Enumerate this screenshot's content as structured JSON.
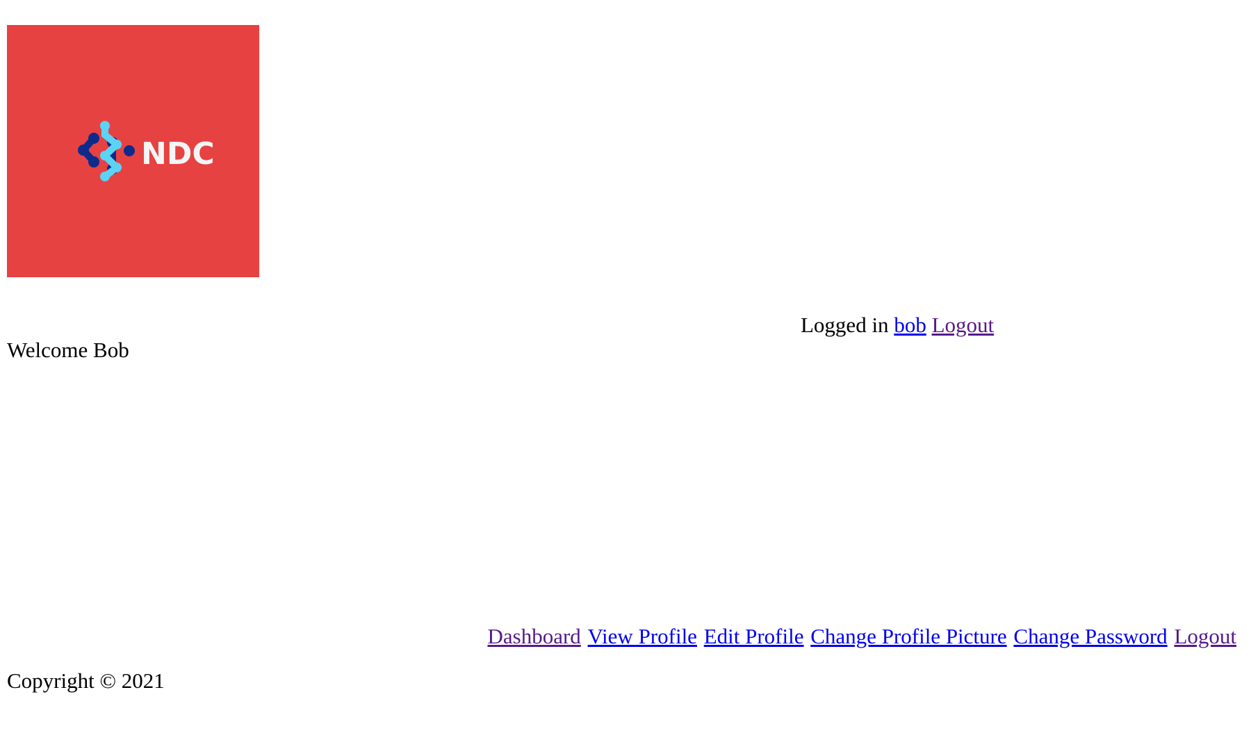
{
  "logo": {
    "text": "NDC",
    "background_color": "#e64242",
    "mark_colors": [
      "#0d2b8a",
      "#5bd3f5"
    ],
    "icon": "ndc-logo-icon"
  },
  "header": {
    "logged_in_text": "Logged in",
    "username_link": "bob",
    "logout_link": "Logout"
  },
  "main": {
    "welcome_text": "Welcome Bob"
  },
  "nav": {
    "items": [
      {
        "label": "Dashboard",
        "visited": true
      },
      {
        "label": "View Profile",
        "visited": false
      },
      {
        "label": "Edit Profile",
        "visited": false
      },
      {
        "label": "Change Profile Picture",
        "visited": false
      },
      {
        "label": "Change Password",
        "visited": false
      },
      {
        "label": "Logout",
        "visited": true
      }
    ]
  },
  "footer": {
    "copyright": "Copyright © 2021"
  },
  "colors": {
    "link": "#0000ee",
    "visited_link": "#551a8b"
  }
}
